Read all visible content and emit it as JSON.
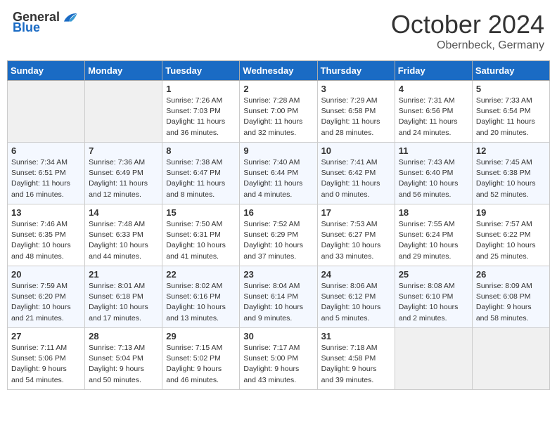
{
  "header": {
    "logo_general": "General",
    "logo_blue": "Blue",
    "title": "October 2024",
    "location": "Obernbeck, Germany"
  },
  "columns": [
    "Sunday",
    "Monday",
    "Tuesday",
    "Wednesday",
    "Thursday",
    "Friday",
    "Saturday"
  ],
  "weeks": [
    [
      {
        "empty": true
      },
      {
        "empty": true
      },
      {
        "day": 1,
        "sunrise": "Sunrise: 7:26 AM",
        "sunset": "Sunset: 7:03 PM",
        "daylight": "Daylight: 11 hours and 36 minutes."
      },
      {
        "day": 2,
        "sunrise": "Sunrise: 7:28 AM",
        "sunset": "Sunset: 7:00 PM",
        "daylight": "Daylight: 11 hours and 32 minutes."
      },
      {
        "day": 3,
        "sunrise": "Sunrise: 7:29 AM",
        "sunset": "Sunset: 6:58 PM",
        "daylight": "Daylight: 11 hours and 28 minutes."
      },
      {
        "day": 4,
        "sunrise": "Sunrise: 7:31 AM",
        "sunset": "Sunset: 6:56 PM",
        "daylight": "Daylight: 11 hours and 24 minutes."
      },
      {
        "day": 5,
        "sunrise": "Sunrise: 7:33 AM",
        "sunset": "Sunset: 6:54 PM",
        "daylight": "Daylight: 11 hours and 20 minutes."
      }
    ],
    [
      {
        "day": 6,
        "sunrise": "Sunrise: 7:34 AM",
        "sunset": "Sunset: 6:51 PM",
        "daylight": "Daylight: 11 hours and 16 minutes."
      },
      {
        "day": 7,
        "sunrise": "Sunrise: 7:36 AM",
        "sunset": "Sunset: 6:49 PM",
        "daylight": "Daylight: 11 hours and 12 minutes."
      },
      {
        "day": 8,
        "sunrise": "Sunrise: 7:38 AM",
        "sunset": "Sunset: 6:47 PM",
        "daylight": "Daylight: 11 hours and 8 minutes."
      },
      {
        "day": 9,
        "sunrise": "Sunrise: 7:40 AM",
        "sunset": "Sunset: 6:44 PM",
        "daylight": "Daylight: 11 hours and 4 minutes."
      },
      {
        "day": 10,
        "sunrise": "Sunrise: 7:41 AM",
        "sunset": "Sunset: 6:42 PM",
        "daylight": "Daylight: 11 hours and 0 minutes."
      },
      {
        "day": 11,
        "sunrise": "Sunrise: 7:43 AM",
        "sunset": "Sunset: 6:40 PM",
        "daylight": "Daylight: 10 hours and 56 minutes."
      },
      {
        "day": 12,
        "sunrise": "Sunrise: 7:45 AM",
        "sunset": "Sunset: 6:38 PM",
        "daylight": "Daylight: 10 hours and 52 minutes."
      }
    ],
    [
      {
        "day": 13,
        "sunrise": "Sunrise: 7:46 AM",
        "sunset": "Sunset: 6:35 PM",
        "daylight": "Daylight: 10 hours and 48 minutes."
      },
      {
        "day": 14,
        "sunrise": "Sunrise: 7:48 AM",
        "sunset": "Sunset: 6:33 PM",
        "daylight": "Daylight: 10 hours and 44 minutes."
      },
      {
        "day": 15,
        "sunrise": "Sunrise: 7:50 AM",
        "sunset": "Sunset: 6:31 PM",
        "daylight": "Daylight: 10 hours and 41 minutes."
      },
      {
        "day": 16,
        "sunrise": "Sunrise: 7:52 AM",
        "sunset": "Sunset: 6:29 PM",
        "daylight": "Daylight: 10 hours and 37 minutes."
      },
      {
        "day": 17,
        "sunrise": "Sunrise: 7:53 AM",
        "sunset": "Sunset: 6:27 PM",
        "daylight": "Daylight: 10 hours and 33 minutes."
      },
      {
        "day": 18,
        "sunrise": "Sunrise: 7:55 AM",
        "sunset": "Sunset: 6:24 PM",
        "daylight": "Daylight: 10 hours and 29 minutes."
      },
      {
        "day": 19,
        "sunrise": "Sunrise: 7:57 AM",
        "sunset": "Sunset: 6:22 PM",
        "daylight": "Daylight: 10 hours and 25 minutes."
      }
    ],
    [
      {
        "day": 20,
        "sunrise": "Sunrise: 7:59 AM",
        "sunset": "Sunset: 6:20 PM",
        "daylight": "Daylight: 10 hours and 21 minutes."
      },
      {
        "day": 21,
        "sunrise": "Sunrise: 8:01 AM",
        "sunset": "Sunset: 6:18 PM",
        "daylight": "Daylight: 10 hours and 17 minutes."
      },
      {
        "day": 22,
        "sunrise": "Sunrise: 8:02 AM",
        "sunset": "Sunset: 6:16 PM",
        "daylight": "Daylight: 10 hours and 13 minutes."
      },
      {
        "day": 23,
        "sunrise": "Sunrise: 8:04 AM",
        "sunset": "Sunset: 6:14 PM",
        "daylight": "Daylight: 10 hours and 9 minutes."
      },
      {
        "day": 24,
        "sunrise": "Sunrise: 8:06 AM",
        "sunset": "Sunset: 6:12 PM",
        "daylight": "Daylight: 10 hours and 5 minutes."
      },
      {
        "day": 25,
        "sunrise": "Sunrise: 8:08 AM",
        "sunset": "Sunset: 6:10 PM",
        "daylight": "Daylight: 10 hours and 2 minutes."
      },
      {
        "day": 26,
        "sunrise": "Sunrise: 8:09 AM",
        "sunset": "Sunset: 6:08 PM",
        "daylight": "Daylight: 9 hours and 58 minutes."
      }
    ],
    [
      {
        "day": 27,
        "sunrise": "Sunrise: 7:11 AM",
        "sunset": "Sunset: 5:06 PM",
        "daylight": "Daylight: 9 hours and 54 minutes."
      },
      {
        "day": 28,
        "sunrise": "Sunrise: 7:13 AM",
        "sunset": "Sunset: 5:04 PM",
        "daylight": "Daylight: 9 hours and 50 minutes."
      },
      {
        "day": 29,
        "sunrise": "Sunrise: 7:15 AM",
        "sunset": "Sunset: 5:02 PM",
        "daylight": "Daylight: 9 hours and 46 minutes."
      },
      {
        "day": 30,
        "sunrise": "Sunrise: 7:17 AM",
        "sunset": "Sunset: 5:00 PM",
        "daylight": "Daylight: 9 hours and 43 minutes."
      },
      {
        "day": 31,
        "sunrise": "Sunrise: 7:18 AM",
        "sunset": "Sunset: 4:58 PM",
        "daylight": "Daylight: 9 hours and 39 minutes."
      },
      {
        "empty": true
      },
      {
        "empty": true
      }
    ]
  ]
}
